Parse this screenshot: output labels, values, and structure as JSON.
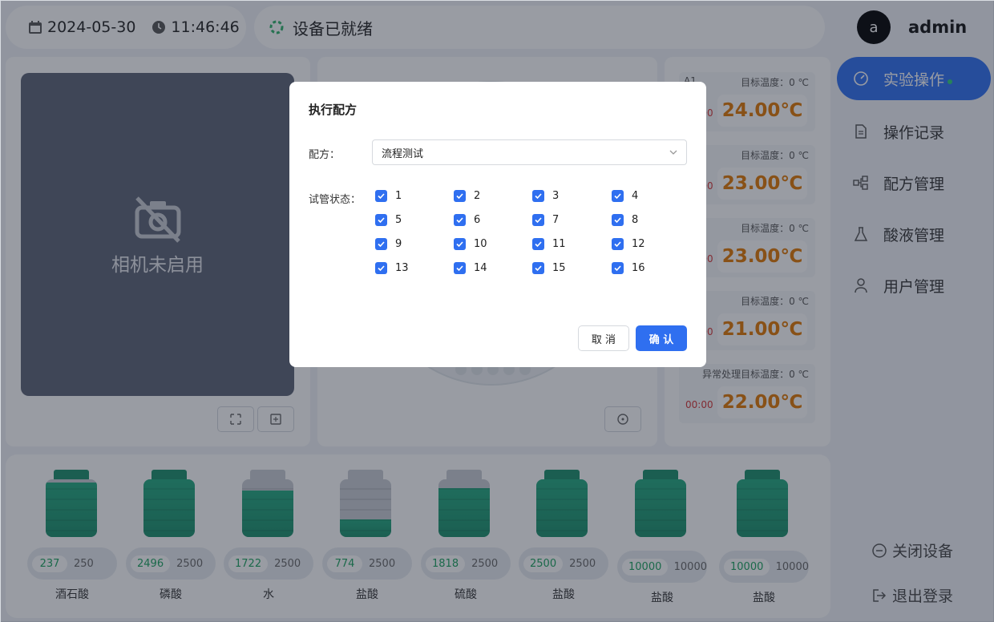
{
  "topbar": {
    "date": "2024-05-30",
    "time": "11:46:46",
    "status": "设备已就绪",
    "icons": [
      "calendar-icon",
      "clock-icon",
      "status-spinner-icon"
    ]
  },
  "user": {
    "avatar_letter": "a",
    "name": "admin"
  },
  "camera": {
    "message": "相机未启用"
  },
  "temperatures": [
    {
      "left_label": "A1",
      "target": "目标温度：0 ℃",
      "timer": "00:00",
      "value": "24.00℃"
    },
    {
      "left_label": "",
      "target": "目标温度：0 ℃",
      "timer": "00:00",
      "value": "23.00℃"
    },
    {
      "left_label": "",
      "target": "目标温度：0 ℃",
      "timer": "00:00",
      "value": "23.00℃"
    },
    {
      "left_label": "",
      "target": "目标温度：0 ℃",
      "timer": "00:00",
      "value": "21.00℃"
    },
    {
      "left_label": "",
      "target": "异常处理目标温度：0 ℃",
      "timer": "00:00",
      "value": "22.00℃"
    }
  ],
  "menu": {
    "items": [
      {
        "label": "实验操作",
        "active": true
      },
      {
        "label": "操作记录",
        "active": false
      },
      {
        "label": "配方管理",
        "active": false
      },
      {
        "label": "酸液管理",
        "active": false
      },
      {
        "label": "用户管理",
        "active": false
      }
    ],
    "shutdown": "关闭设备",
    "logout": "退出登录"
  },
  "bottles": [
    {
      "name": "酒石酸",
      "current": "237",
      "max": "250",
      "level": 0.95,
      "cap": "#1a8f6a"
    },
    {
      "name": "磷酸",
      "current": "2496",
      "max": "2500",
      "level": 1.0,
      "cap": "#1a8f6a"
    },
    {
      "name": "水",
      "current": "1722",
      "max": "2500",
      "level": 0.8,
      "cap": "#c8ccd3"
    },
    {
      "name": "盐酸",
      "current": "774",
      "max": "2500",
      "level": 0.31,
      "cap": "#c8ccd3"
    },
    {
      "name": "硫酸",
      "current": "1818",
      "max": "2500",
      "level": 0.85,
      "cap": "#c8ccd3"
    },
    {
      "name": "盐酸",
      "current": "2500",
      "max": "2500",
      "level": 1.0,
      "cap": "#1a8f6a"
    },
    {
      "name": "盐酸",
      "current": "10000",
      "max": "10000",
      "level": 1.0,
      "cap": "#1a8f6a"
    },
    {
      "name": "盐酸",
      "current": "10000",
      "max": "10000",
      "level": 1.0,
      "cap": "#1a8f6a"
    }
  ],
  "modal": {
    "title": "执行配方",
    "recipe_label": "配方：",
    "recipe_value": "流程测试",
    "tube_label": "试管状态：",
    "tubes": [
      "1",
      "2",
      "3",
      "4",
      "5",
      "6",
      "7",
      "8",
      "9",
      "10",
      "11",
      "12",
      "13",
      "14",
      "15",
      "16"
    ],
    "cancel": "取 消",
    "confirm": "确 认"
  },
  "colors": {
    "accent": "#2f6ff0",
    "temperature": "#e07700",
    "liquid": "#1a8f6a"
  }
}
